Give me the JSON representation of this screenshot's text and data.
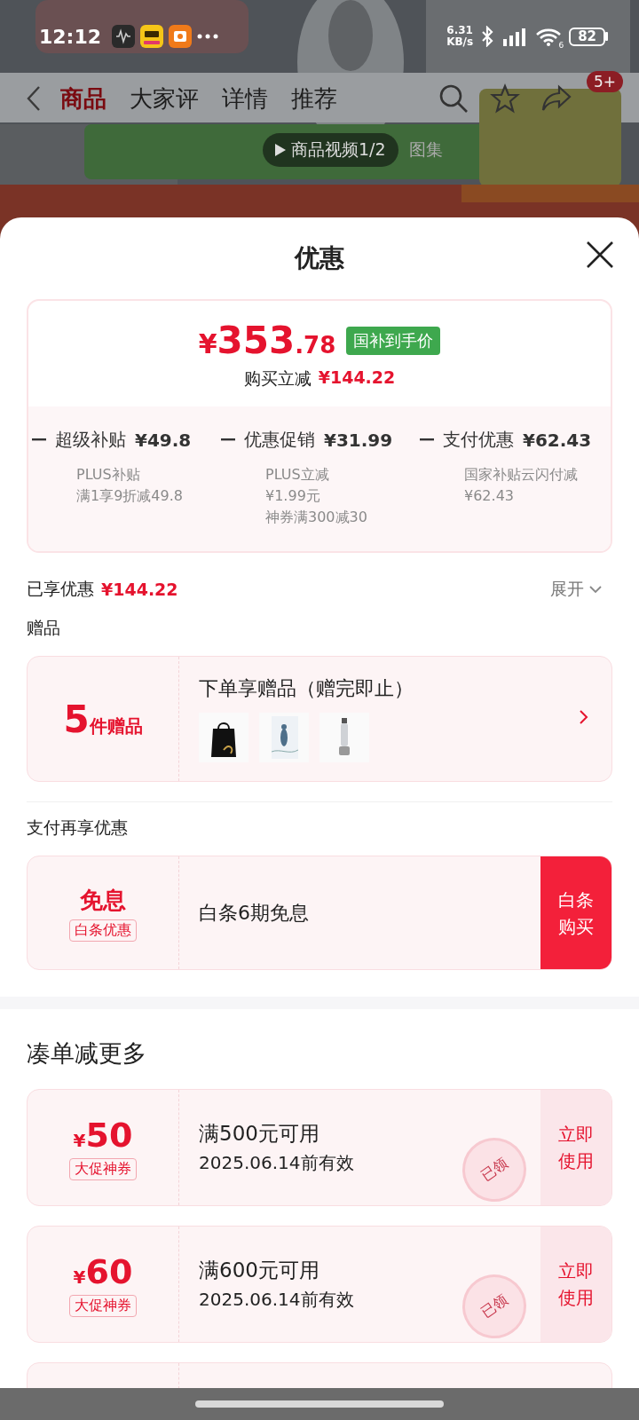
{
  "status_bar": {
    "time": "12:12",
    "net_speed": "6.31",
    "net_unit": "KB/s",
    "wifi_badge": "6",
    "battery": "82"
  },
  "product_nav": {
    "tabs": [
      {
        "label": "商品",
        "selected": true
      },
      {
        "label": "大家评",
        "selected": false
      },
      {
        "label": "详情",
        "selected": false
      },
      {
        "label": "推荐",
        "selected": false
      }
    ],
    "badge": "5+",
    "video_button": "商品视频1/2",
    "gallery_tab": "图集"
  },
  "sheet": {
    "title": "优惠",
    "price": {
      "currency": "¥",
      "integer": "353",
      "decimal": ".78",
      "tag": "国补到手价",
      "saving_label": "购买立减",
      "saving_amount": "¥144.22"
    },
    "breakdown": [
      {
        "label": "超级补贴",
        "amount": "¥49.8",
        "details": [
          "PLUS补贴",
          "满1享9折减49.8"
        ]
      },
      {
        "label": "优惠促销",
        "amount": "¥31.99",
        "details": [
          "PLUS立减",
          "¥1.99元",
          "神券满300减30"
        ]
      },
      {
        "label": "支付优惠",
        "amount": "¥62.43",
        "details": [
          "国家补贴云闪付减",
          "¥62.43"
        ]
      }
    ],
    "enjoyed": {
      "label": "已享优惠",
      "amount": "¥144.22",
      "expand": "展开"
    },
    "gifts": {
      "heading": "赠品",
      "count": "5",
      "count_unit": "件赠品",
      "title": "下单享赠品（赠完即止）"
    },
    "payment": {
      "heading": "支付再享优惠",
      "badge_title": "免息",
      "badge_tag": "白条优惠",
      "text": "白条6期免息",
      "button": "白条购买"
    },
    "coupons": {
      "heading": "凑单减更多",
      "items": [
        {
          "currency": "¥",
          "amount": "50",
          "tag": "大促神券",
          "condition": "满500元可用",
          "expiry": "2025.06.14前有效",
          "action": "立即使用",
          "stamp": "已领"
        },
        {
          "currency": "¥",
          "amount": "60",
          "tag": "大促神券",
          "condition": "满600元可用",
          "expiry": "2025.06.14前有效",
          "action": "立即使用",
          "stamp": "已领"
        }
      ]
    }
  }
}
